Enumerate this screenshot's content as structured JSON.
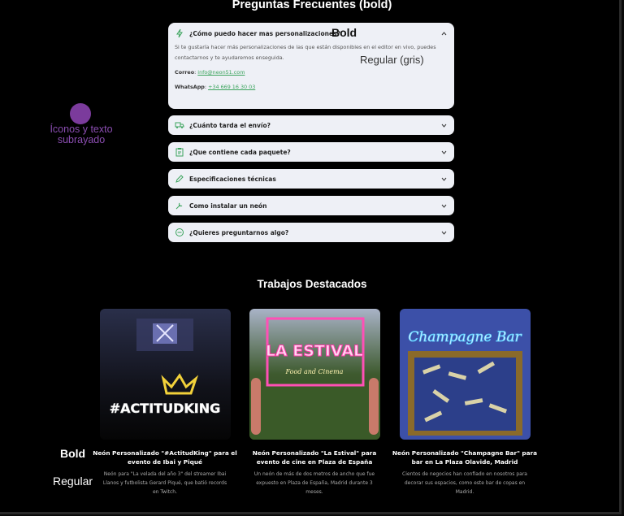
{
  "faq": {
    "title": "Preguntas Frecuentes (bold)",
    "open_item": {
      "question": "¿Cómo puedo hacer mas personalizaciones?",
      "icon": "bolt-icon",
      "answer": "Si te gustaría hacer más personalizaciones de las que están disponibles en el editor en vivo, puedes contactarnos y te ayudaremos enseguida.",
      "email_label": "Correo",
      "email": "info@neon51.com",
      "whatsapp_label": "WhatsApp",
      "whatsapp": "+34 669 16 30 03"
    },
    "items": [
      {
        "question": "¿Cuánto tarda el envío?",
        "icon": "truck-icon"
      },
      {
        "question": "¿Que contiene cada paquete?",
        "icon": "clipboard-icon"
      },
      {
        "question": "Especificaciones técnicas",
        "icon": "pencil-icon"
      },
      {
        "question": "Como instalar un neón",
        "icon": "tools-icon"
      },
      {
        "question": "¿Quieres preguntarnos algo?",
        "icon": "minus-circle-icon"
      }
    ]
  },
  "annotations": {
    "bold": "Bold",
    "regular_gray": "Regular (gris)",
    "icons_text": "Íconos y texto subrayado",
    "side_bold": "Bold",
    "side_regular": "Regular"
  },
  "works": {
    "title": "Trabajos Destacados",
    "cards": [
      {
        "title": "Neón Personalizado \"#ActitudKing\" para el evento de Ibai y Piqué",
        "description": "Neón para \"La velada del año 3\" del streamer Ibai Llanos y futbolista Gerard Piqué, que batió records en Twitch.",
        "image_text": "#ACTITUDKING"
      },
      {
        "title": "Neón Personalizado \"La Estival\" para evento de cine en Plaza de España",
        "description": "Un neón de más de dos metros de ancho que fue expuesto en Plaza de España, Madrid durante 3 meses.",
        "image_text": "LA ESTIVAL",
        "image_subtext": "Food and Cinema"
      },
      {
        "title": "Neón Personalizado \"Champagne Bar\" para bar en La Plaza Olavide, Madrid",
        "description": "Cientos de negocios han confiado en nosotros para decorar sus espacios, como este bar de copas en Madrid.",
        "image_text": "Champagne Bar"
      }
    ]
  },
  "colors": {
    "background": "#000000",
    "faq_card": "#eef0f6",
    "accent_green": "#3aa35c",
    "annotation_purple": "#7b3b9c"
  }
}
